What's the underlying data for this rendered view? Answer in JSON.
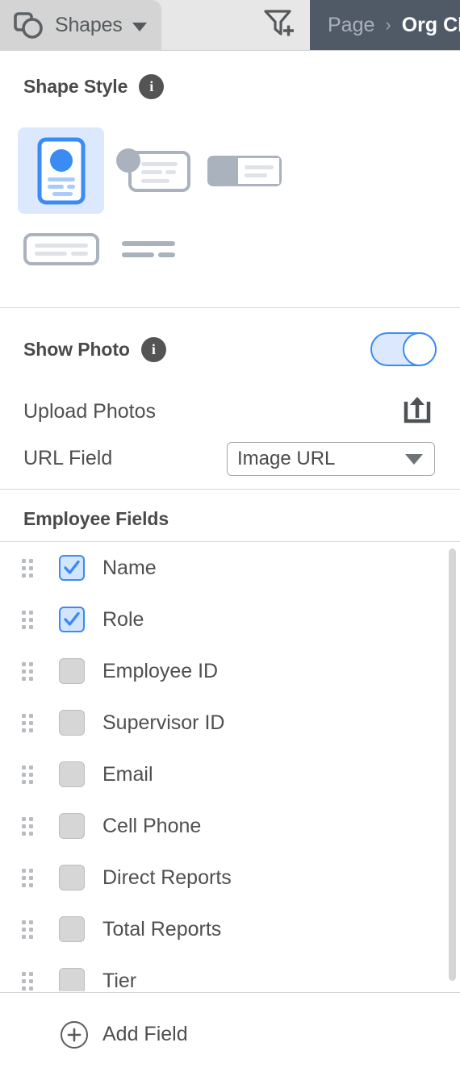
{
  "toolbar": {
    "shapes_button_label": "Shapes",
    "shapes_icon": "shapes-square-circle-icon",
    "dropdown_caret_icon": "caret-down-icon",
    "filter_icon": "filter-add-icon"
  },
  "breadcrumb": {
    "parent": "Page",
    "separator": "›",
    "current": "Org Ch"
  },
  "shape_style": {
    "title": "Shape Style",
    "info_icon": "info-icon",
    "options": [
      {
        "name": "vertical-photo-card",
        "selected": true
      },
      {
        "name": "avatar-left-card",
        "selected": false
      },
      {
        "name": "solid-block-card",
        "selected": false
      },
      {
        "name": "plain-text-card",
        "selected": false
      },
      {
        "name": "lines-only-card",
        "selected": false
      }
    ]
  },
  "show_photo": {
    "title": "Show Photo",
    "info_icon": "info-icon",
    "toggle_on": true,
    "upload_label": "Upload Photos",
    "upload_icon": "upload-icon",
    "url_field_label": "URL Field",
    "url_field_value": "Image URL",
    "url_field_caret": "caret-down-icon"
  },
  "employee_fields": {
    "title": "Employee Fields",
    "items": [
      {
        "label": "Name",
        "checked": true
      },
      {
        "label": "Role",
        "checked": true
      },
      {
        "label": "Employee ID",
        "checked": false
      },
      {
        "label": "Supervisor ID",
        "checked": false
      },
      {
        "label": "Email",
        "checked": false
      },
      {
        "label": "Cell Phone",
        "checked": false
      },
      {
        "label": "Direct Reports",
        "checked": false
      },
      {
        "label": "Total Reports",
        "checked": false
      },
      {
        "label": "Tier",
        "checked": false
      }
    ]
  },
  "add_field": {
    "label": "Add Field",
    "icon": "plus-circle-icon"
  },
  "colors": {
    "accent_blue": "#3b8bf5",
    "accent_blue_light": "#dbe8fd",
    "breadcrumb_bg": "#505a66",
    "toolbar_bg": "#e7e7e7",
    "shapes_btn_bg": "#d4d4d4",
    "text_dark": "#4a4a4a",
    "shape_gray": "#aab2bd",
    "divider": "#d6d6d6"
  }
}
